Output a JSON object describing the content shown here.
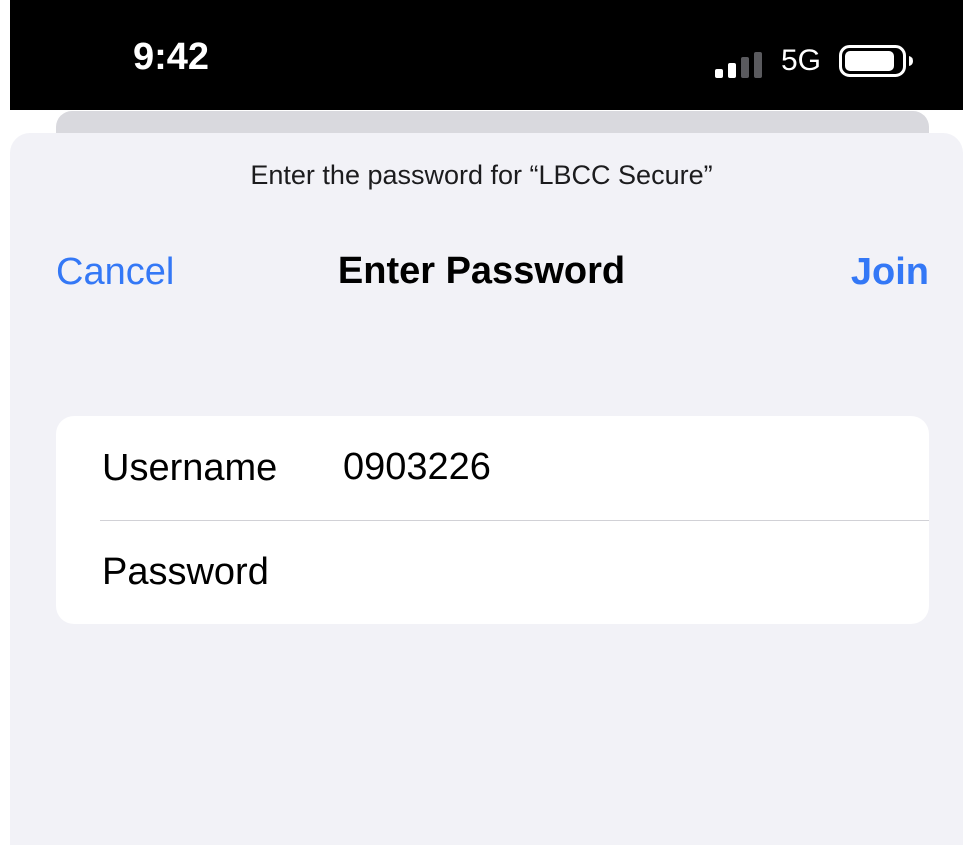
{
  "status_bar": {
    "time": "9:42",
    "network": "5G",
    "signal_icon": "cellular-signal-icon",
    "battery_icon": "battery-icon"
  },
  "dialog": {
    "prompt": "Enter the password for “LBCC Secure”",
    "title": "Enter Password",
    "cancel_label": "Cancel",
    "join_label": "Join",
    "accent_color": "#3478f6",
    "background_color": "#f2f2f7"
  },
  "form": {
    "username": {
      "label": "Username",
      "value": "0903226"
    },
    "password": {
      "label": "Password",
      "value": ""
    }
  }
}
